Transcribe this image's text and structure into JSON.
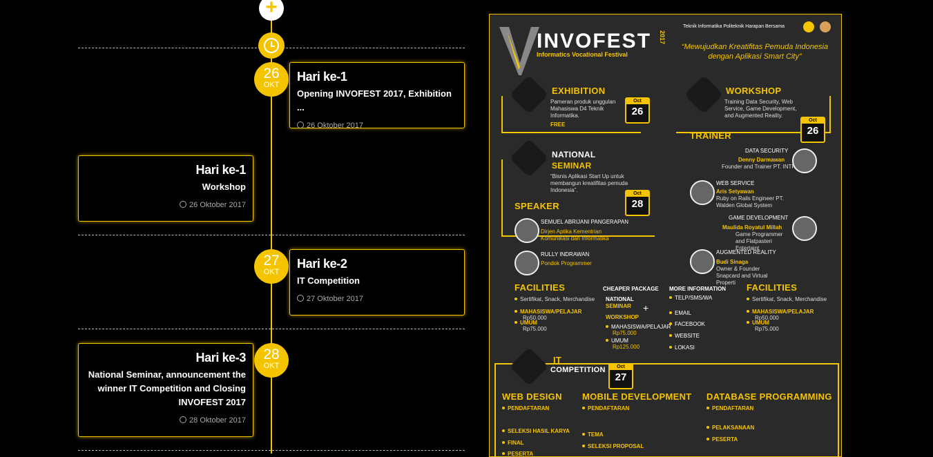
{
  "timeline": {
    "cards": [
      {
        "title": "Hari ke-1",
        "subtitle": "Opening INVOFEST 2017, Exhibition ...",
        "date": "26 Oktober 2017",
        "day": "26",
        "month": "OKT"
      },
      {
        "title": "Hari ke-1",
        "subtitle": "Workshop",
        "date": "26 Oktober 2017"
      },
      {
        "title": "Hari ke-2",
        "subtitle": "IT Competition",
        "date": "27 Oktober 2017",
        "day": "27",
        "month": "OKT"
      },
      {
        "title": "Hari ke-3",
        "subtitle": "National Seminar, announcement the winner IT Competition and Closing INVOFEST 2017",
        "date": "28 Oktober 2017",
        "day": "28",
        "month": "OKT"
      }
    ],
    "icons": {
      "top": "plus-icon",
      "clock": "clock-icon"
    }
  },
  "poster": {
    "org": "Teknik Informatika Politeknik Harapan Bersama",
    "logo_main": "INVOFEST",
    "logo_year": "2017",
    "logo_sub": "Informatics Vocational Festival",
    "tagline": "“Mewujudkan Kreatifitas Pemuda Indonesia dengan Aplikasi Smart City”",
    "exhibition": {
      "title": "EXHIBITION",
      "text": "Pameran produk unggulan Mahasiswa D4 Teknik Informatika.",
      "free": "FREE",
      "month": "Oct",
      "day": "26"
    },
    "workshop": {
      "title": "WORKSHOP",
      "text": "Training Data Security, Web Service, Game Development, and Augmented Reality.",
      "month": "Oct",
      "day": "26"
    },
    "trainer": {
      "title": "TRAINER",
      "items": [
        {
          "topic": "DATA SECURITY",
          "name": "Denny Darmawan",
          "role": "Founder and Trainer PT. INTRA"
        },
        {
          "topic": "WEB SERVICE",
          "name": "Aris Setyawan",
          "role": "Ruby on Rails Engineer PT. Walden Global System"
        },
        {
          "topic": "GAME DEVELOPMENT",
          "name": "Maulida Royatul Millah",
          "role": "Game Programmer and Flatpasteri Entertaint"
        },
        {
          "topic": "AUGMENTED REALITY",
          "name": "Budi Sinaga",
          "role": "Owner & Founder Snapcard and Virtual Properti"
        }
      ]
    },
    "seminar": {
      "title1": "NATIONAL",
      "title2": "SEMINAR",
      "text": "“Bisnis Aplikasi Start Up untuk membangun kreatifitas pemuda Indonesia”.",
      "month": "Oct",
      "day": "28"
    },
    "speaker": {
      "title": "SPEAKER",
      "items": [
        {
          "name": "SEMUEL ABRIJANI PANGERAPAN",
          "role": "Dirjen Aptika Kementrian Komunikasi dan Informatika"
        },
        {
          "name": "RULLY INDRAWAN",
          "role": "Pondok Programmer"
        }
      ]
    },
    "facilities_left": {
      "title": "FACILITIES",
      "items": [
        "Sertifikat, Snack, Merchandise",
        "MAHASISWA/PELAJAR",
        "UMUM"
      ],
      "prices": [
        "",
        "Rp50.000",
        "Rp75.000"
      ]
    },
    "package": {
      "title": "CHEAPER PACKAGE",
      "l1": "NATIONAL",
      "l2": "SEMINAR",
      "plus": "+",
      "l3": "WORKSHOP",
      "p1": "MAHASISWA/PELAJAR",
      "v1": "Rp75.000",
      "p2": "UMUM",
      "v2": "Rp125.000"
    },
    "info": {
      "title": "MORE INFORMATION",
      "items": [
        "TELP/SMS/WA",
        "EMAIL",
        "FACEBOOK",
        "WEBSITE",
        "LOKASI"
      ]
    },
    "facilities_right": {
      "title": "FACILITIES",
      "items": [
        "Sertifikat, Snack, Merchandise",
        "MAHASISWA/PELAJAR",
        "UMUM"
      ],
      "prices": [
        "",
        "Rp50.000",
        "Rp75.000"
      ]
    },
    "it": {
      "title1": "IT",
      "title2": "COMPETITION",
      "month": "Oct",
      "day": "27"
    },
    "columns": [
      {
        "title": "WEB DESIGN",
        "items": [
          "PENDAFTARAN",
          "SELEKSI HASIL KARYA",
          "FINAL",
          "PESERTA"
        ]
      },
      {
        "title": "MOBILE DEVELOPMENT",
        "items": [
          "PENDAFTARAN",
          "TEMA",
          "SELEKSI PROPOSAL"
        ]
      },
      {
        "title": "DATABASE PROGRAMMING",
        "items": [
          "PENDAFTARAN",
          "PELAKSANAAN",
          "PESERTA"
        ]
      }
    ]
  }
}
